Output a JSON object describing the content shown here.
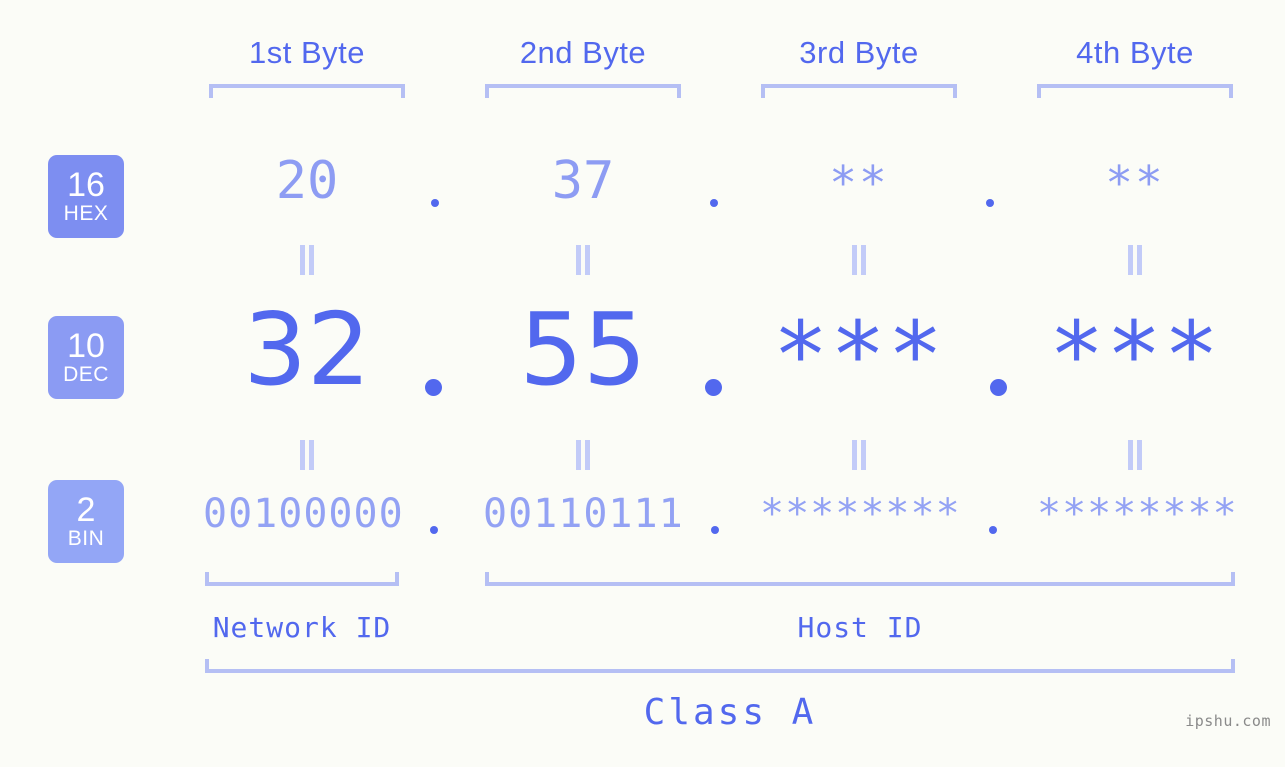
{
  "watermark": "ipshu.com",
  "byte_headers": [
    {
      "label": "1st Byte"
    },
    {
      "label": "2nd Byte"
    },
    {
      "label": "3rd Byte"
    },
    {
      "label": "4th Byte"
    }
  ],
  "bases": [
    {
      "num": "16",
      "name": "HEX",
      "color": "#7d8ef1"
    },
    {
      "num": "10",
      "name": "DEC",
      "color": "#8b9bf3"
    },
    {
      "num": "2",
      "name": "BIN",
      "color": "#93a6f6"
    }
  ],
  "rows": {
    "hex": {
      "values": [
        "20",
        "37",
        "**",
        "**"
      ]
    },
    "dec": {
      "values": [
        "32",
        "55",
        "***",
        "***"
      ]
    },
    "bin": {
      "values": [
        "00100000",
        "00110111",
        "********",
        "********"
      ]
    }
  },
  "separators": {
    "dot": "."
  },
  "equals_marks": {
    "glyph": "||"
  },
  "sections": [
    {
      "label": "Network ID"
    },
    {
      "label": "Host ID"
    }
  ],
  "class_label": "Class A",
  "colors": {
    "background": "#fbfcf7",
    "accent": "#5268ee",
    "light": "#b5bff4",
    "muted": "#93a2f4"
  }
}
